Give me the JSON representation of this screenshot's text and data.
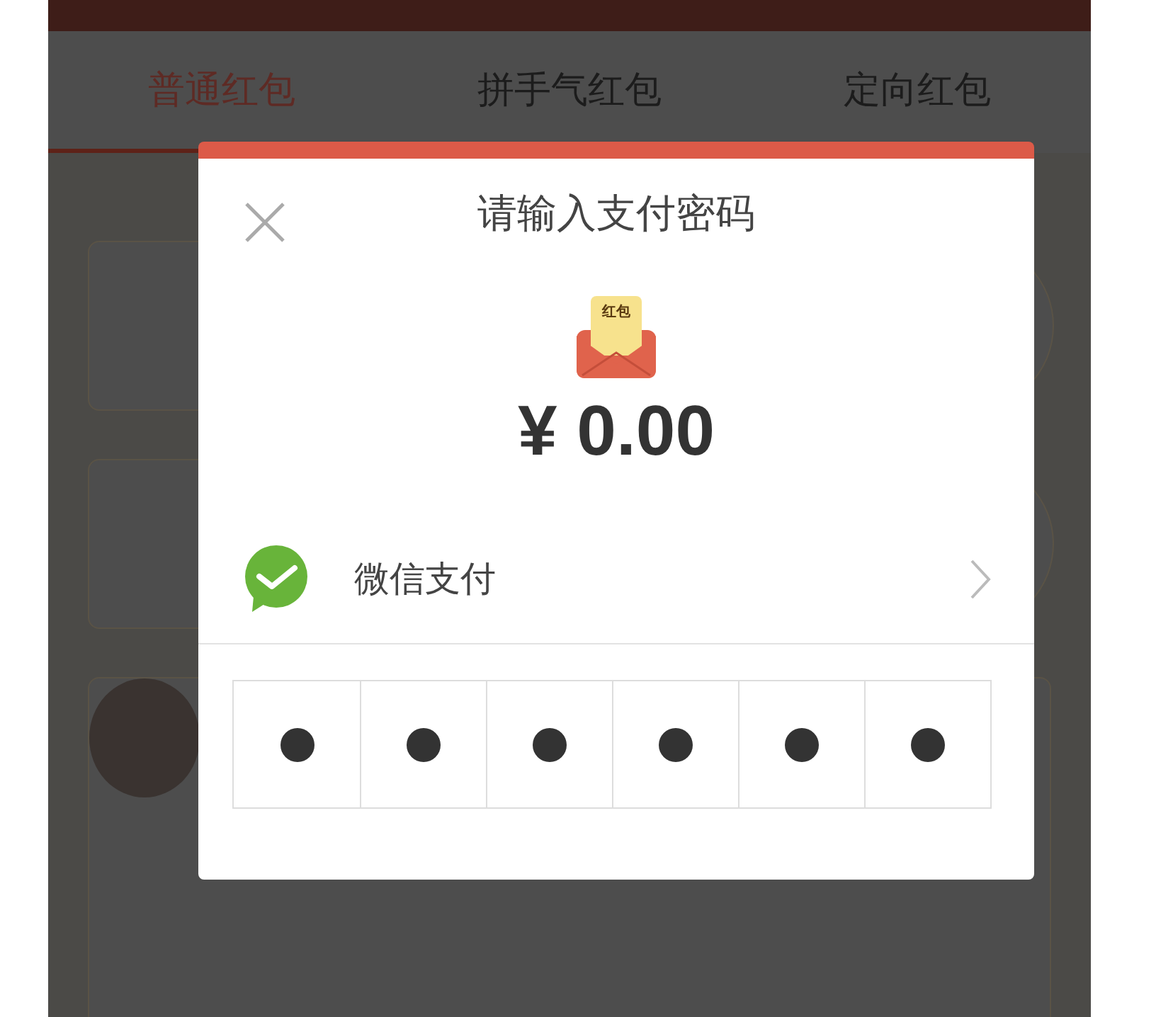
{
  "tabs": [
    {
      "label": "普通红包",
      "selected": true
    },
    {
      "label": "拼手气红包",
      "selected": false
    },
    {
      "label": "定向红包",
      "selected": false
    }
  ],
  "dialog": {
    "title": "请输入支付密码",
    "envelope_label": "红包",
    "amount": "¥ 0.00",
    "payment_method": {
      "label": "微信支付"
    },
    "password_cells": [
      {
        "filled": true
      },
      {
        "filled": true
      },
      {
        "filled": true
      },
      {
        "filled": true
      },
      {
        "filled": true
      },
      {
        "filled": true
      }
    ]
  }
}
